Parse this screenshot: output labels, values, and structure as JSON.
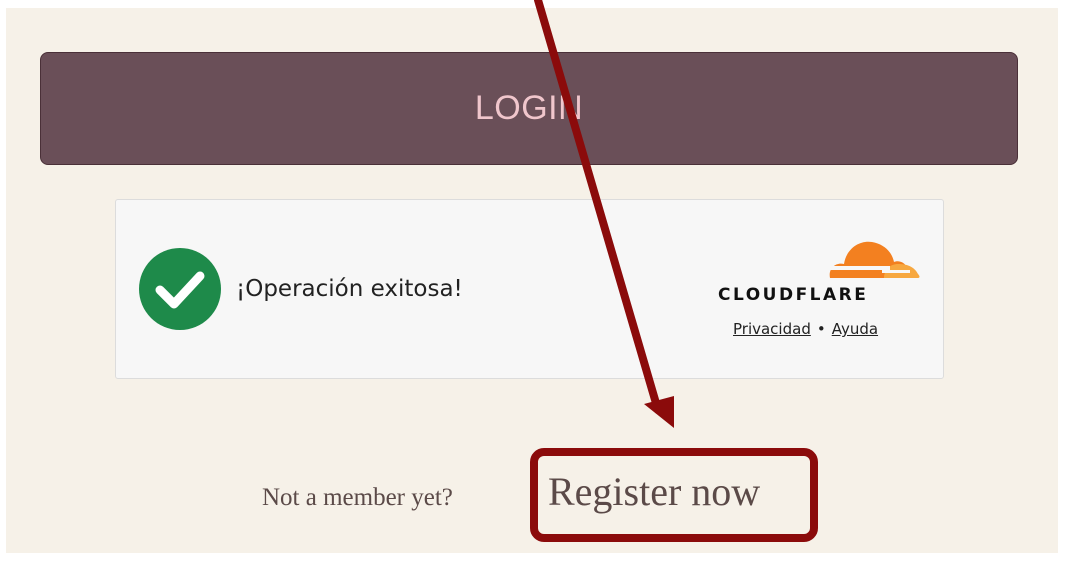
{
  "login": {
    "label": "LOGIN"
  },
  "captcha": {
    "status_text": "¡Operación exitosa!",
    "status_icon": "check-circle-icon",
    "brand": "CLOUDFLARE",
    "brand_icon": "cloudflare-cloud-icon",
    "privacy_link": "Privacidad",
    "separator": "•",
    "help_link": "Ayuda"
  },
  "register": {
    "prompt": "Not a member yet?",
    "link": "Register now"
  },
  "annotation": {
    "color": "#8b0b0b"
  },
  "colors": {
    "login_bg": "#6a4f58",
    "login_text": "#f0c6cc",
    "success_green": "#1e8a4a",
    "cloudflare_orange": "#f38020"
  }
}
